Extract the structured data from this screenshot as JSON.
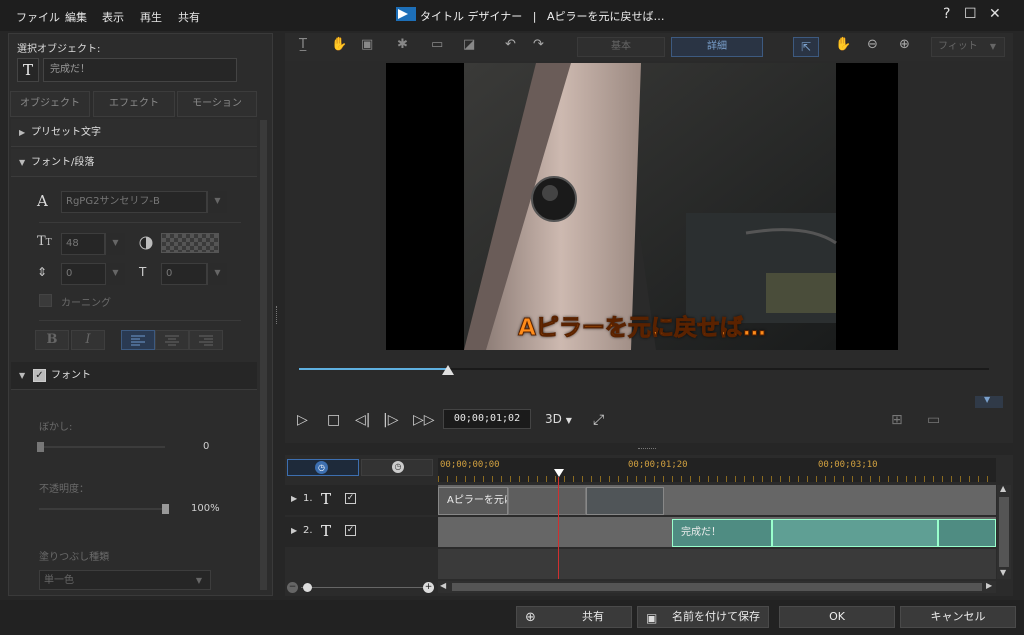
{
  "menu": [
    "ファイル",
    "編集",
    "表示",
    "再生",
    "共有"
  ],
  "window": {
    "app": "タイトル デザイナー",
    "separator": "|",
    "doc": "Aピラーを元に戻せば…",
    "help": "?",
    "maximize": "☐",
    "close": "✕"
  },
  "left": {
    "selected_label": "選択オブジェクト:",
    "selected_value": "完成だ！",
    "tabs": [
      "オブジェクト",
      "エフェクト",
      "モーション"
    ],
    "preset_text": "プリセット文字",
    "font_paragraph": "フォント/段落",
    "font_name": "RgPG2サンセリフ-B",
    "font_size": "48",
    "line_spacing": "0",
    "char_spacing": "0",
    "kerning": "カーニング",
    "bold": "B",
    "italic": "I",
    "font_section": "フォント",
    "blur_label": "ぼかし:",
    "blur_value": "0",
    "opacity_label": "不透明度：",
    "opacity_value": "100%",
    "fill_type_label": "塗りつぶし種類",
    "fill_type_value": "単一色"
  },
  "toolbar": {
    "basic": "基本",
    "detail": "詳細",
    "fit": "フィット"
  },
  "preview": {
    "caption": "Aピラーを元に戻せば…",
    "timecode": "00;00;01;02",
    "mode_3d": "3D",
    "progress": 0.216
  },
  "timeline": {
    "ruler": [
      "00;00;00;00",
      "00;00;01;20",
      "00;00;03;10"
    ],
    "tracks": [
      {
        "num": "1.",
        "clip": "Aピラーを元に戻せば…"
      },
      {
        "num": "2.",
        "clip": "完成だ！"
      }
    ]
  },
  "buttons": {
    "share": "共有",
    "save_as": "名前を付けて保存",
    "ok": "OK",
    "cancel": "キャンセル"
  },
  "colors": {
    "accent": "#5fb0e0",
    "caption": "#ff8c1a",
    "clip_teal": "#5f9f94",
    "playhead": "#d03030"
  }
}
